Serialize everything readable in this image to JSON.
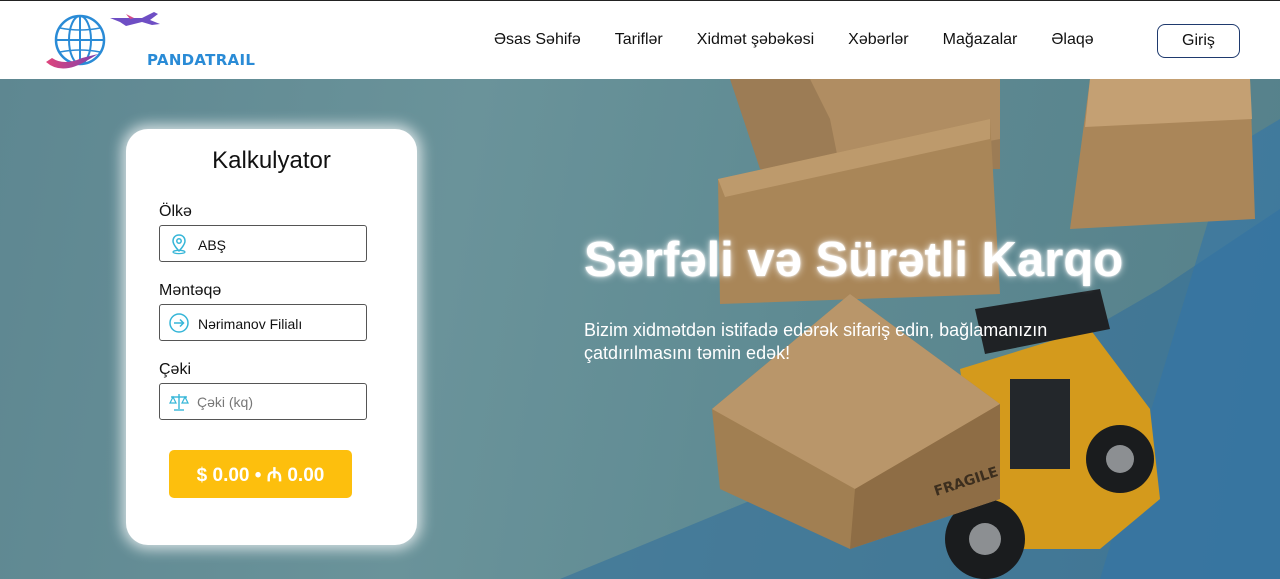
{
  "brand": {
    "name": "PANDATRAIL"
  },
  "nav": {
    "items": [
      {
        "label": "Əsas Səhifə"
      },
      {
        "label": "Tariflər"
      },
      {
        "label": "Xidmət şəbəkəsi"
      },
      {
        "label": "Xəbərlər"
      },
      {
        "label": "Mağazalar"
      },
      {
        "label": "Əlaqə"
      }
    ],
    "login_label": "Giriş"
  },
  "hero": {
    "title": "Sərfəli və Sürətli Karqo",
    "subtitle": "Bizim xidmətdən istifadə edərək sifariş edin, bağlamanızın çatdırılmasını təmin edək!",
    "box_label": "FRAGILE"
  },
  "calculator": {
    "title": "Kalkulyator",
    "country": {
      "label": "Ölkə",
      "value": "ABŞ",
      "icon": "location-pin-icon"
    },
    "point": {
      "label": "Məntəqə",
      "value": "Nərimanov Filialı",
      "icon": "arrow-circle-icon"
    },
    "weight": {
      "label": "Çəki",
      "placeholder": "Çəki (kq)",
      "value": "",
      "icon": "scale-icon"
    },
    "price_label": "$ 0.00 • ₼ 0.00"
  },
  "colors": {
    "accent": "#fdbf0d",
    "icon": "#36b6d8",
    "login_border": "#1f3a6e",
    "brand": "#2a8bd6"
  }
}
